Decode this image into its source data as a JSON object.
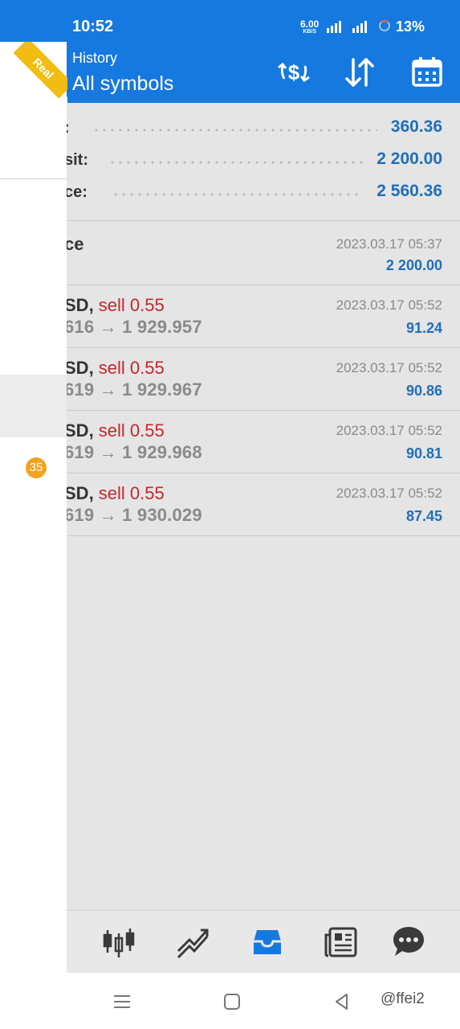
{
  "status_bar": {
    "time": "10:52",
    "net_speed": "6.00",
    "net_unit": "KB/S",
    "battery": "13%"
  },
  "header": {
    "subtitle": "History",
    "title": "All symbols",
    "icons": [
      "currency-exchange-icon",
      "sort-icon",
      "calendar-icon"
    ]
  },
  "badge_real": "Real",
  "summary": [
    {
      "label": ":",
      "value": "360.36"
    },
    {
      "label": "sit:",
      "value": "2 200.00"
    },
    {
      "label": "ce:",
      "value": "2 560.36"
    }
  ],
  "balance_entry": {
    "label": "ce",
    "date": "2023.03.17 05:37",
    "amount": "2 200.00"
  },
  "deals": [
    {
      "symbol": "SD",
      "sep": ", ",
      "action": "sell 0.55",
      "prices": "616 → 1 929.957",
      "date": "2023.03.17 05:52",
      "profit": "91.24"
    },
    {
      "symbol": "SD",
      "sep": ", ",
      "action": "sell 0.55",
      "prices": "619 → 1 929.967",
      "date": "2023.03.17 05:52",
      "profit": "90.86"
    },
    {
      "symbol": "SD",
      "sep": ", ",
      "action": "sell 0.55",
      "prices": "619 → 1 929.968",
      "date": "2023.03.17 05:52",
      "profit": "90.81"
    },
    {
      "symbol": "SD",
      "sep": ", ",
      "action": "sell 0.55",
      "prices": "619 → 1 930.029",
      "date": "2023.03.17 05:52",
      "profit": "87.45"
    }
  ],
  "drawer": {
    "badge_count": "35"
  },
  "bottom_nav": [
    "quotes-icon",
    "chart-icon",
    "history-icon",
    "news-icon",
    "chat-icon"
  ],
  "colors": {
    "primary": "#1679e0",
    "sell": "#c4262c",
    "value_blue": "#1f6fba",
    "ribbon": "#f2bd10",
    "badge": "#f0a323"
  },
  "watermark": "@ffei2"
}
